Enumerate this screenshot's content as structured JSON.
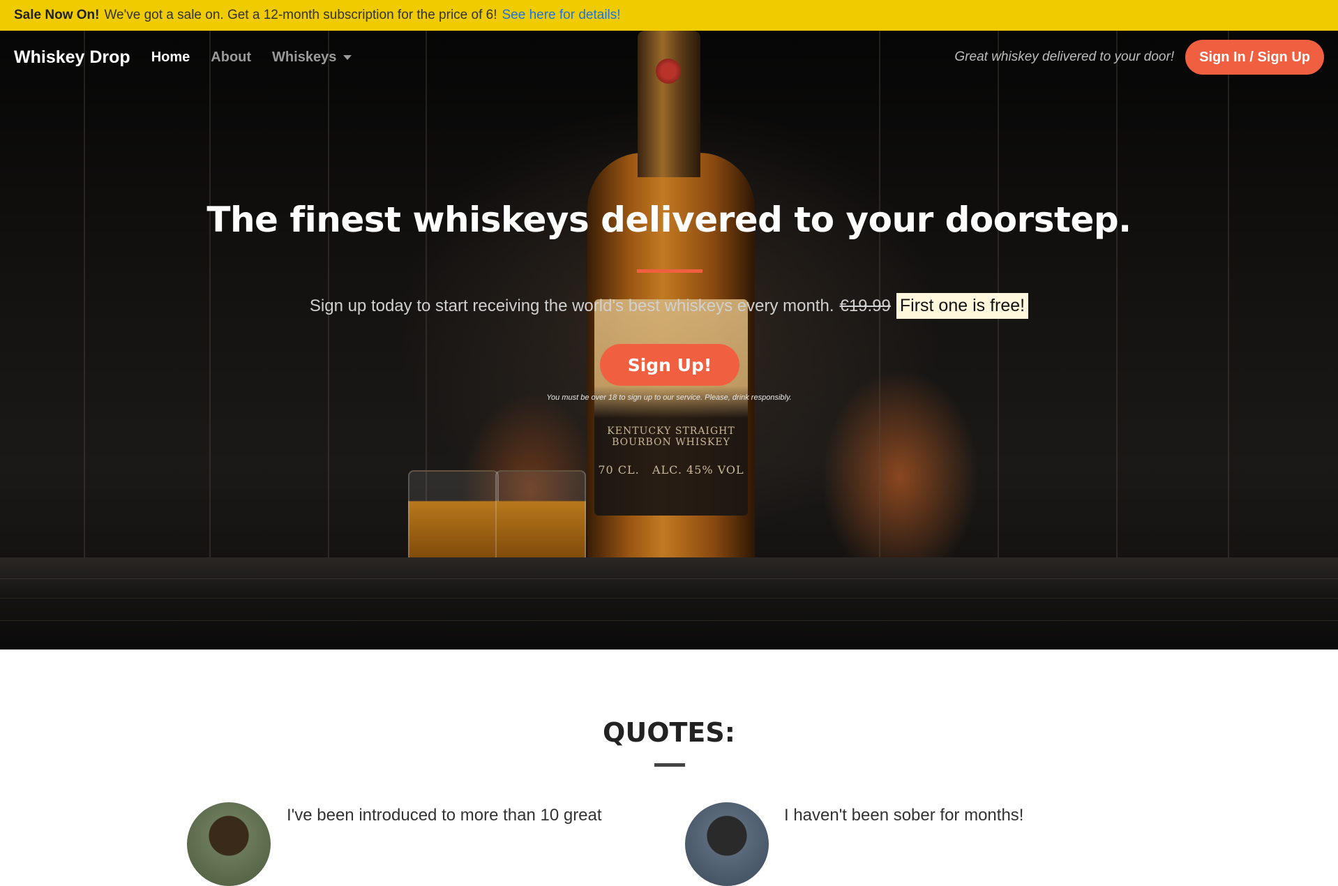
{
  "announcement": {
    "bold": "Sale Now On!",
    "text": "We've got a sale on. Get a 12-month subscription for the price of 6!",
    "link": "See here for details!"
  },
  "nav": {
    "brand": "Whiskey Drop",
    "links": [
      "Home",
      "About",
      "Whiskeys"
    ],
    "tagline": "Great whiskey delivered to your door!",
    "signin": "Sign In / Sign Up"
  },
  "hero": {
    "title": "The finest whiskeys delivered to your doorstep.",
    "subtitle": "Sign up today to start receiving the world's best whiskeys every month.",
    "old_price": "€19.99",
    "free": "First one is free!",
    "button": "Sign Up!",
    "fine_print": "You must be over 18 to sign up to our service. Please, drink responsibly.",
    "bottle_label": {
      "line1": "KENTUCKY STRAIGHT",
      "line2": "BOURBON WHISKEY",
      "volume": "70 CL.",
      "abv": "ALC. 45% VOL"
    }
  },
  "quotes": {
    "title": "QUOTES:",
    "items": [
      {
        "text": "I've been introduced to more than 10 great"
      },
      {
        "text": "I haven't been sober for months!"
      }
    ]
  },
  "colors": {
    "accent": "#f05f40",
    "announcement_bg": "#f0cb00",
    "link": "#1a73e8"
  }
}
